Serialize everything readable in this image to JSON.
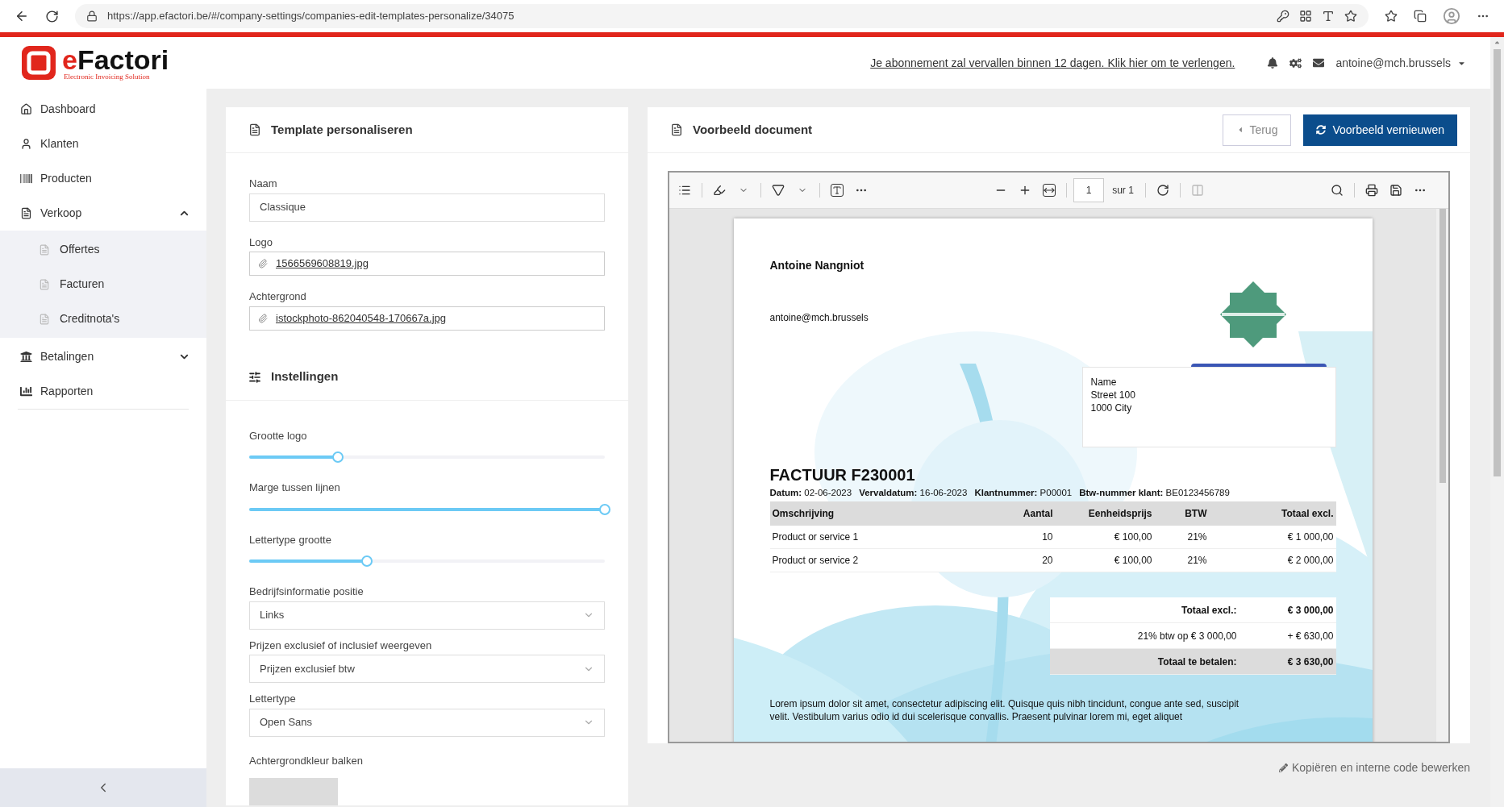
{
  "browser": {
    "url": "https://app.efactori.be/#/company-settings/companies-edit-templates-personalize/34075"
  },
  "brand": {
    "prefix": "e",
    "name": "Factori",
    "tagline": "Electronic Invoicing Solution"
  },
  "header": {
    "notice": "Je abonnement zal vervallen binnen 12 dagen. Klik hier om te verlengen.",
    "user": "antoine@mch.brussels"
  },
  "sidebar": {
    "items": [
      {
        "kind": "home",
        "label": "Dashboard"
      },
      {
        "kind": "user",
        "label": "Klanten"
      },
      {
        "kind": "barcode",
        "label": "Producten"
      },
      {
        "kind": "document",
        "label": "Verkoop",
        "expanded": true,
        "children": [
          {
            "label": "Offertes"
          },
          {
            "label": "Facturen"
          },
          {
            "label": "Creditnota's"
          }
        ]
      },
      {
        "kind": "bank",
        "label": "Betalingen",
        "expanded": false
      },
      {
        "kind": "chart",
        "label": "Rapporten"
      }
    ]
  },
  "template_panel": {
    "title": "Template personaliseren",
    "fields": [
      {
        "kind": "text",
        "label": "Naam",
        "value": "Classique"
      },
      {
        "kind": "file",
        "label": "Logo",
        "value": "1566569608819.jpg"
      },
      {
        "kind": "file",
        "label": "Achtergrond",
        "value": "istockphoto-862040548-170667a.jpg"
      }
    ],
    "settings_title": "Instellingen",
    "settings": [
      {
        "kind": "slider",
        "label": "Grootte logo",
        "level": 0.25
      },
      {
        "kind": "slider",
        "label": "Marge tussen lijnen",
        "level": 1
      },
      {
        "kind": "slider",
        "label": "Lettertype grootte",
        "level": 0.33
      },
      {
        "kind": "select",
        "label": "Bedrijfsinformatie positie",
        "value": "Links"
      },
      {
        "kind": "select",
        "label": "Prijzen exclusief of inclusief weergeven",
        "value": "Prijzen exclusief btw"
      },
      {
        "kind": "select",
        "label": "Lettertype",
        "value": "Open Sans"
      },
      {
        "kind": "color",
        "label": "Achtergrondkleur balken",
        "color": "#dcdcdc"
      }
    ]
  },
  "preview_panel": {
    "title": "Voorbeeld document",
    "back_button": "Terug",
    "refresh_button": "Voorbeeld vernieuwen",
    "viewer": {
      "page": "1",
      "page_total": "sur 1"
    },
    "document": {
      "sender_name": "Antoine Nangniot",
      "sender_email": "antoine@mch.brussels",
      "address": [
        "Name",
        "Street 100",
        "1000 City"
      ],
      "title": "FACTUUR F230001",
      "meta": [
        "**Datum:** 02-06-2023",
        "**Vervaldatum:** 16-06-2023",
        "**Klantnummer:** P00001",
        "**Btw-nummer klant:** BE0123456789"
      ],
      "table": {
        "columns": [
          "Omschrijving",
          "Aantal",
          "Eenheidsprijs",
          "BTW",
          "Totaal excl."
        ],
        "rows": [
          [
            "Product or service 1",
            "10",
            "€ 100,00",
            "21%",
            "€ 1 000,00"
          ],
          [
            "Product or service 2",
            "20",
            "€ 100,00",
            "21%",
            "€ 2 000,00"
          ]
        ]
      },
      "totals": [
        {
          "kind": "subtotal",
          "label": "Totaal excl.:",
          "value": "€ 3 000,00"
        },
        {
          "kind": "tax",
          "label": "21% btw op € 3 000,00",
          "value": "+ € 630,00"
        },
        {
          "kind": "total",
          "label": "Totaal te betalen:",
          "value": "€ 3 630,00"
        }
      ],
      "note": "Lorem ipsum dolor sit amet, consectetur adipiscing elit. Quisque quis nibh tincidunt, congue ante sed, suscipit velit. Vestibulum varius odio id dui scelerisque convallis. Praesent pulvinar lorem mi, eget aliquet"
    }
  },
  "footer_link": "Kopiëren en interne code bewerken"
}
